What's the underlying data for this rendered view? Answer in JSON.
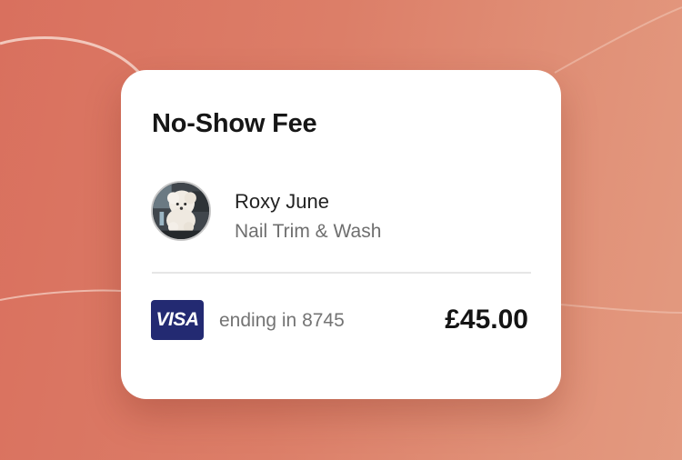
{
  "colors": {
    "background_start": "#d9705e",
    "background_end": "#e39a80",
    "card_background": "#ffffff",
    "brand_badge": "#232a72"
  },
  "fee": {
    "title": "No-Show Fee"
  },
  "client": {
    "name": "Roxy June",
    "service": "Nail Trim & Wash",
    "avatar_icon": "dog-avatar-icon"
  },
  "payment": {
    "brand": "VISA",
    "ending": "ending in 8745",
    "amount": "£45.00"
  }
}
